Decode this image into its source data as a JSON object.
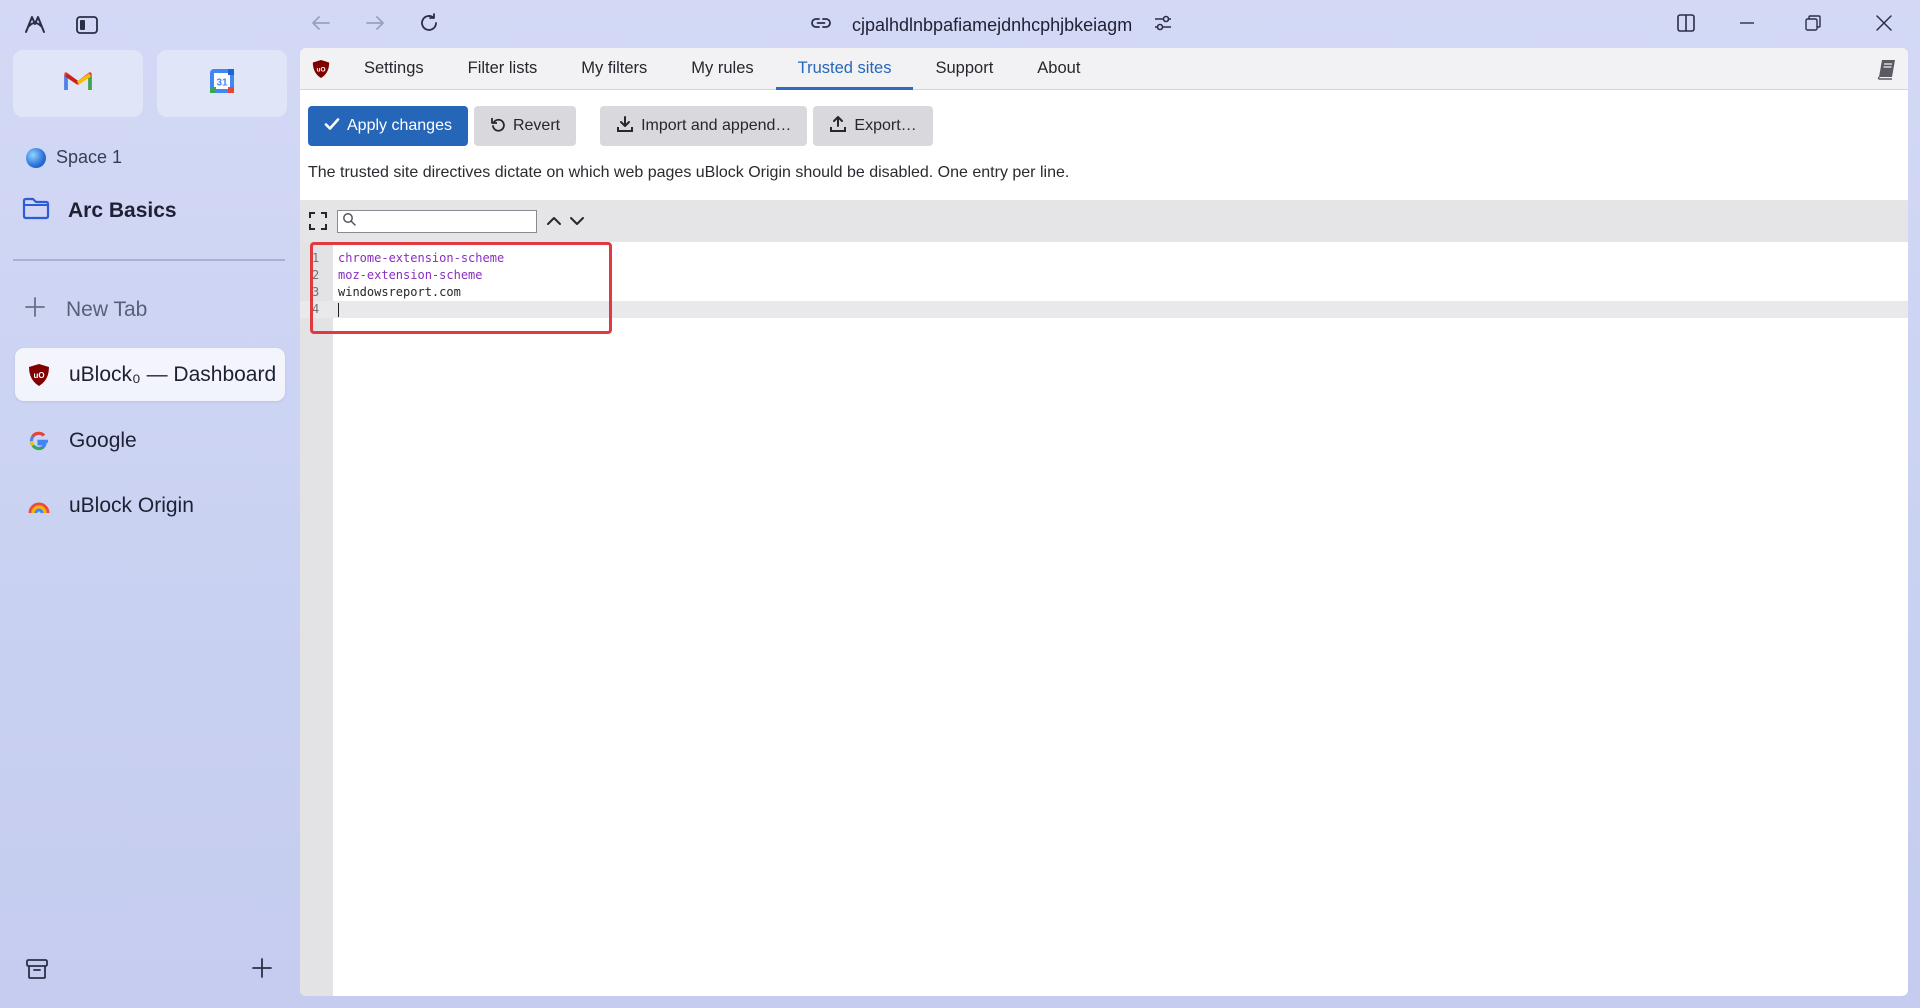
{
  "sidebar": {
    "space_name": "Space 1",
    "folder_name": "Arc Basics",
    "new_tab_label": "New Tab",
    "tabs": [
      {
        "label": "uBlock₀ — Dashboard",
        "icon": "ublock-icon",
        "active": true
      },
      {
        "label": "Google",
        "icon": "google-icon",
        "active": false
      },
      {
        "label": "uBlock Origin",
        "icon": "rainbow-icon",
        "active": false
      }
    ],
    "favorites": [
      {
        "icon": "gmail-icon"
      },
      {
        "icon": "google-calendar-icon",
        "label": "31"
      }
    ]
  },
  "titlebar": {
    "url": "cjpalhdlnbpafiamejdnhcphjbkeiagm"
  },
  "dashboard": {
    "tabs": [
      {
        "label": "Settings",
        "active": false
      },
      {
        "label": "Filter lists",
        "active": false
      },
      {
        "label": "My filters",
        "active": false
      },
      {
        "label": "My rules",
        "active": false
      },
      {
        "label": "Trusted sites",
        "active": true
      },
      {
        "label": "Support",
        "active": false
      },
      {
        "label": "About",
        "active": false
      }
    ],
    "buttons": {
      "apply": "Apply changes",
      "revert": "Revert",
      "import": "Import and append…",
      "export": "Export…"
    },
    "description": "The trusted site directives dictate on which web pages uBlock Origin should be disabled. One entry per line.",
    "search_placeholder": "",
    "lines": [
      {
        "n": "1",
        "text": "chrome-extension-scheme",
        "style": "kw"
      },
      {
        "n": "2",
        "text": "moz-extension-scheme",
        "style": "kw"
      },
      {
        "n": "3",
        "text": "windowsreport.com",
        "style": "plain"
      },
      {
        "n": "4",
        "text": "",
        "style": "plain"
      }
    ]
  },
  "colors": {
    "accent": "#2566b8",
    "highlight_border": "#e0393f",
    "ublock_red": "#800000"
  }
}
